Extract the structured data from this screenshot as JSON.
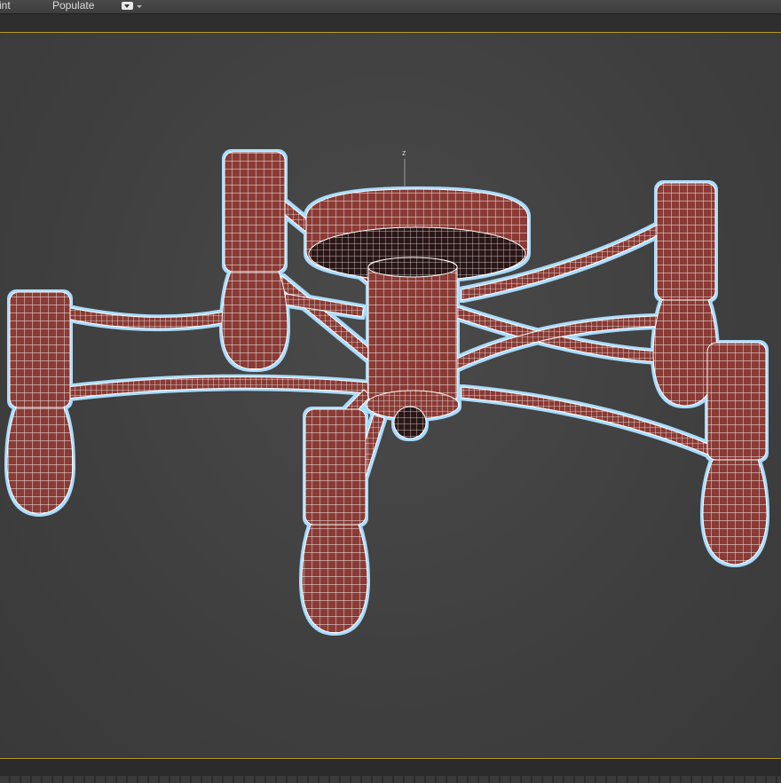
{
  "toolbar": {
    "items": [
      "int",
      "Populate"
    ],
    "dropdown_icon": "display-dropdown-icon"
  },
  "viewport": {
    "axis_label": "z",
    "frame_color": "#b59a2a",
    "background": "#3f3f3f",
    "model": {
      "description_icon": "chandelier-wireframe",
      "mesh_color": "#8a3a36",
      "wire_color": "#ffffff",
      "selection_glow": "#a8dcff",
      "arm_count": 6
    }
  }
}
